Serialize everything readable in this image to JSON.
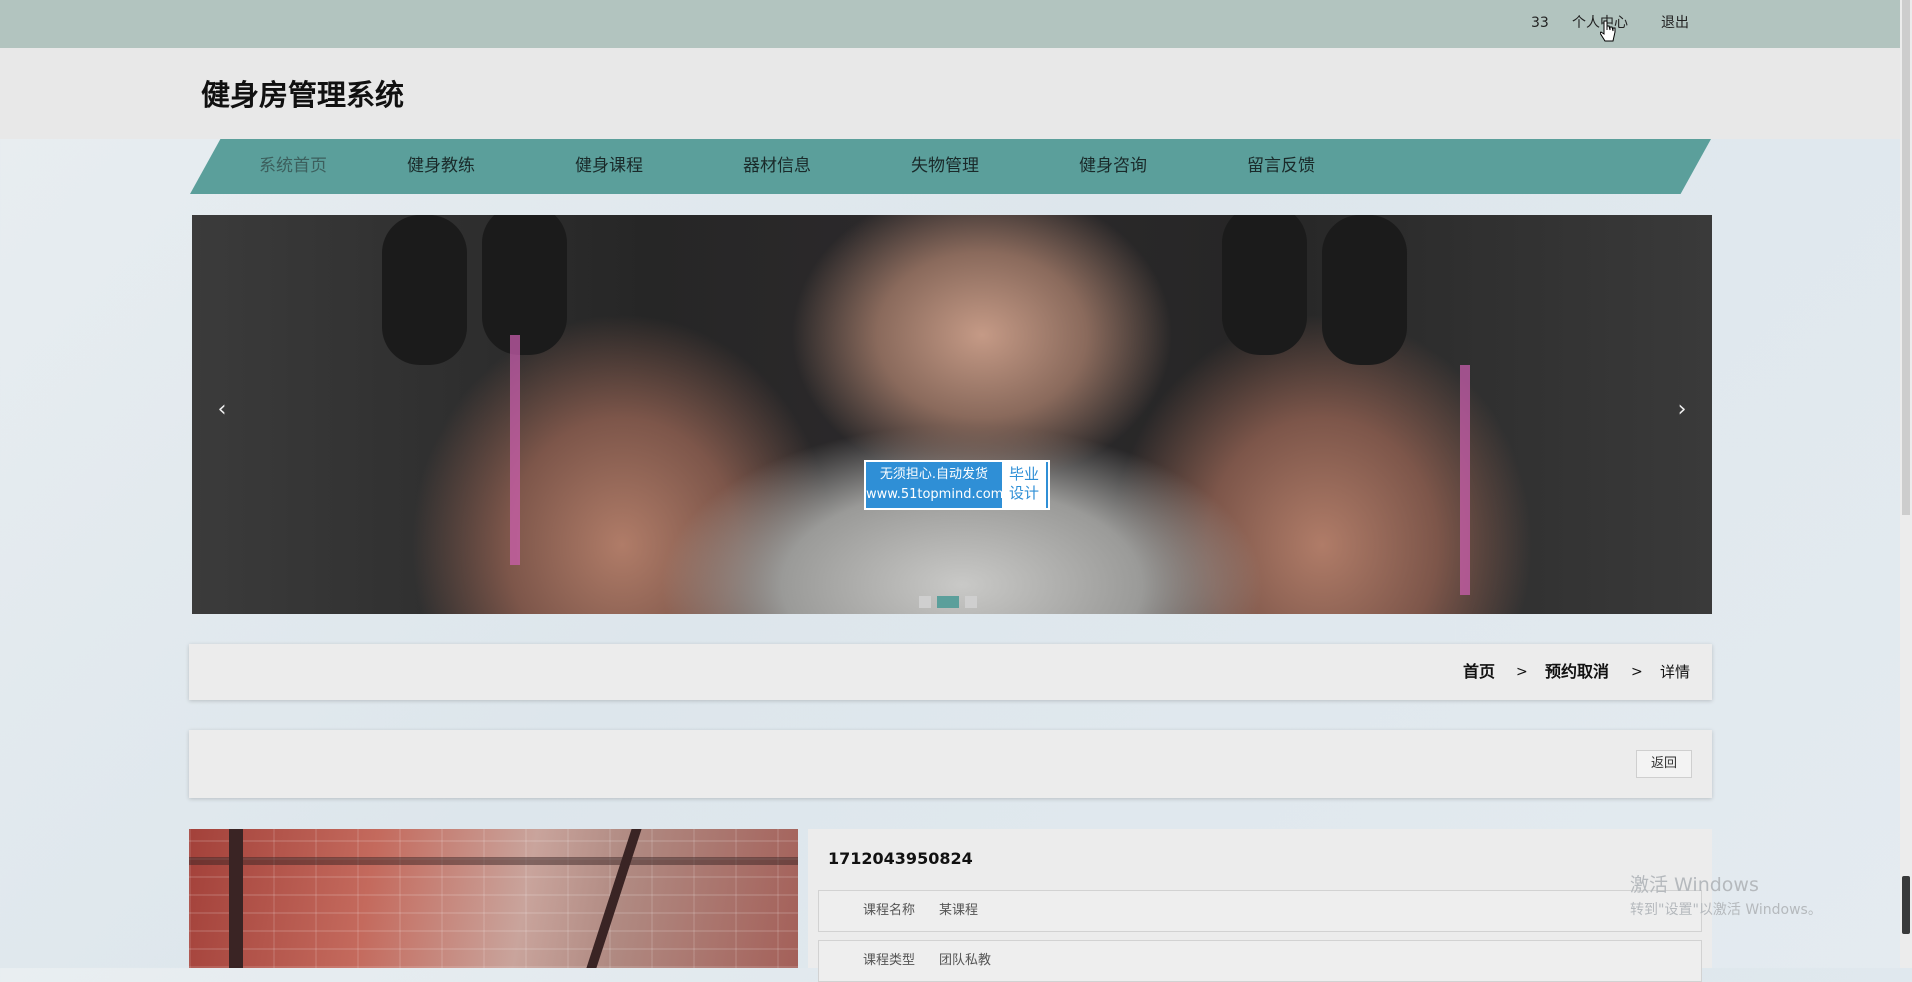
{
  "topbar": {
    "user_number": "33",
    "profile_link": "个人中心",
    "logout_link": "退出"
  },
  "header": {
    "site_title": "健身房管理系统"
  },
  "nav": {
    "items": [
      {
        "label": "系统首页",
        "active": true
      },
      {
        "label": "健身教练"
      },
      {
        "label": "健身课程"
      },
      {
        "label": "器材信息"
      },
      {
        "label": "失物管理"
      },
      {
        "label": "健身咨询"
      },
      {
        "label": "留言反馈"
      }
    ]
  },
  "banner": {
    "prev_arrow": "‹",
    "next_arrow": "›",
    "watermark": {
      "line1": "无须担心.自动发货",
      "line2": "www.51topmind.com",
      "right_line1": "毕业",
      "right_line2": "设计"
    },
    "slides_count": 3,
    "active_slide": 2
  },
  "breadcrumb": {
    "home": "首页",
    "sep1": ">",
    "section": "预约取消",
    "sep2": ">",
    "current": "详情"
  },
  "actions": {
    "back_label": "返回"
  },
  "detail": {
    "id": "1712043950824",
    "fields": [
      {
        "label": "课程名称",
        "value": "某课程"
      },
      {
        "label": "课程类型",
        "value": "团队私教"
      }
    ]
  },
  "windows_activation": {
    "line1": "激活 Windows",
    "line2": "转到\"设置\"以激活 Windows。"
  },
  "colors": {
    "topbar": "#b2c4bf",
    "nav": "#5b9f9b",
    "accent": "#5b9f9b"
  }
}
